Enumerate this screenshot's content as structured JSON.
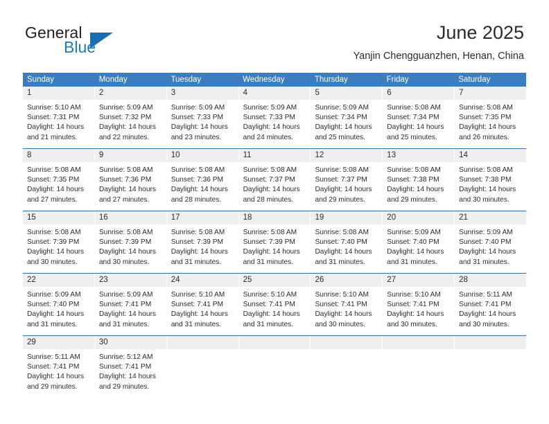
{
  "brand": {
    "name_part1": "General",
    "name_part2": "Blue",
    "triangle_icon": "triangle-icon",
    "accent_color": "#1b6cb0"
  },
  "header": {
    "title": "June 2025",
    "subtitle": "Yanjin Chengguanzhen, Henan, China"
  },
  "colors": {
    "header_blue": "#3b7dbf",
    "week_divider": "#2f6ca8",
    "daynum_band": "#efefef",
    "text": "#2b2b2b"
  },
  "weekday_headers": [
    "Sunday",
    "Monday",
    "Tuesday",
    "Wednesday",
    "Thursday",
    "Friday",
    "Saturday"
  ],
  "weeks": [
    [
      {
        "day": "1",
        "sunrise": "Sunrise: 5:10 AM",
        "sunset": "Sunset: 7:31 PM",
        "daylight1": "Daylight: 14 hours",
        "daylight2": "and 21 minutes."
      },
      {
        "day": "2",
        "sunrise": "Sunrise: 5:09 AM",
        "sunset": "Sunset: 7:32 PM",
        "daylight1": "Daylight: 14 hours",
        "daylight2": "and 22 minutes."
      },
      {
        "day": "3",
        "sunrise": "Sunrise: 5:09 AM",
        "sunset": "Sunset: 7:33 PM",
        "daylight1": "Daylight: 14 hours",
        "daylight2": "and 23 minutes."
      },
      {
        "day": "4",
        "sunrise": "Sunrise: 5:09 AM",
        "sunset": "Sunset: 7:33 PM",
        "daylight1": "Daylight: 14 hours",
        "daylight2": "and 24 minutes."
      },
      {
        "day": "5",
        "sunrise": "Sunrise: 5:09 AM",
        "sunset": "Sunset: 7:34 PM",
        "daylight1": "Daylight: 14 hours",
        "daylight2": "and 25 minutes."
      },
      {
        "day": "6",
        "sunrise": "Sunrise: 5:08 AM",
        "sunset": "Sunset: 7:34 PM",
        "daylight1": "Daylight: 14 hours",
        "daylight2": "and 25 minutes."
      },
      {
        "day": "7",
        "sunrise": "Sunrise: 5:08 AM",
        "sunset": "Sunset: 7:35 PM",
        "daylight1": "Daylight: 14 hours",
        "daylight2": "and 26 minutes."
      }
    ],
    [
      {
        "day": "8",
        "sunrise": "Sunrise: 5:08 AM",
        "sunset": "Sunset: 7:35 PM",
        "daylight1": "Daylight: 14 hours",
        "daylight2": "and 27 minutes."
      },
      {
        "day": "9",
        "sunrise": "Sunrise: 5:08 AM",
        "sunset": "Sunset: 7:36 PM",
        "daylight1": "Daylight: 14 hours",
        "daylight2": "and 27 minutes."
      },
      {
        "day": "10",
        "sunrise": "Sunrise: 5:08 AM",
        "sunset": "Sunset: 7:36 PM",
        "daylight1": "Daylight: 14 hours",
        "daylight2": "and 28 minutes."
      },
      {
        "day": "11",
        "sunrise": "Sunrise: 5:08 AM",
        "sunset": "Sunset: 7:37 PM",
        "daylight1": "Daylight: 14 hours",
        "daylight2": "and 28 minutes."
      },
      {
        "day": "12",
        "sunrise": "Sunrise: 5:08 AM",
        "sunset": "Sunset: 7:37 PM",
        "daylight1": "Daylight: 14 hours",
        "daylight2": "and 29 minutes."
      },
      {
        "day": "13",
        "sunrise": "Sunrise: 5:08 AM",
        "sunset": "Sunset: 7:38 PM",
        "daylight1": "Daylight: 14 hours",
        "daylight2": "and 29 minutes."
      },
      {
        "day": "14",
        "sunrise": "Sunrise: 5:08 AM",
        "sunset": "Sunset: 7:38 PM",
        "daylight1": "Daylight: 14 hours",
        "daylight2": "and 30 minutes."
      }
    ],
    [
      {
        "day": "15",
        "sunrise": "Sunrise: 5:08 AM",
        "sunset": "Sunset: 7:39 PM",
        "daylight1": "Daylight: 14 hours",
        "daylight2": "and 30 minutes."
      },
      {
        "day": "16",
        "sunrise": "Sunrise: 5:08 AM",
        "sunset": "Sunset: 7:39 PM",
        "daylight1": "Daylight: 14 hours",
        "daylight2": "and 30 minutes."
      },
      {
        "day": "17",
        "sunrise": "Sunrise: 5:08 AM",
        "sunset": "Sunset: 7:39 PM",
        "daylight1": "Daylight: 14 hours",
        "daylight2": "and 31 minutes."
      },
      {
        "day": "18",
        "sunrise": "Sunrise: 5:08 AM",
        "sunset": "Sunset: 7:39 PM",
        "daylight1": "Daylight: 14 hours",
        "daylight2": "and 31 minutes."
      },
      {
        "day": "19",
        "sunrise": "Sunrise: 5:08 AM",
        "sunset": "Sunset: 7:40 PM",
        "daylight1": "Daylight: 14 hours",
        "daylight2": "and 31 minutes."
      },
      {
        "day": "20",
        "sunrise": "Sunrise: 5:09 AM",
        "sunset": "Sunset: 7:40 PM",
        "daylight1": "Daylight: 14 hours",
        "daylight2": "and 31 minutes."
      },
      {
        "day": "21",
        "sunrise": "Sunrise: 5:09 AM",
        "sunset": "Sunset: 7:40 PM",
        "daylight1": "Daylight: 14 hours",
        "daylight2": "and 31 minutes."
      }
    ],
    [
      {
        "day": "22",
        "sunrise": "Sunrise: 5:09 AM",
        "sunset": "Sunset: 7:40 PM",
        "daylight1": "Daylight: 14 hours",
        "daylight2": "and 31 minutes."
      },
      {
        "day": "23",
        "sunrise": "Sunrise: 5:09 AM",
        "sunset": "Sunset: 7:41 PM",
        "daylight1": "Daylight: 14 hours",
        "daylight2": "and 31 minutes."
      },
      {
        "day": "24",
        "sunrise": "Sunrise: 5:10 AM",
        "sunset": "Sunset: 7:41 PM",
        "daylight1": "Daylight: 14 hours",
        "daylight2": "and 31 minutes."
      },
      {
        "day": "25",
        "sunrise": "Sunrise: 5:10 AM",
        "sunset": "Sunset: 7:41 PM",
        "daylight1": "Daylight: 14 hours",
        "daylight2": "and 31 minutes."
      },
      {
        "day": "26",
        "sunrise": "Sunrise: 5:10 AM",
        "sunset": "Sunset: 7:41 PM",
        "daylight1": "Daylight: 14 hours",
        "daylight2": "and 30 minutes."
      },
      {
        "day": "27",
        "sunrise": "Sunrise: 5:10 AM",
        "sunset": "Sunset: 7:41 PM",
        "daylight1": "Daylight: 14 hours",
        "daylight2": "and 30 minutes."
      },
      {
        "day": "28",
        "sunrise": "Sunrise: 5:11 AM",
        "sunset": "Sunset: 7:41 PM",
        "daylight1": "Daylight: 14 hours",
        "daylight2": "and 30 minutes."
      }
    ],
    [
      {
        "day": "29",
        "sunrise": "Sunrise: 5:11 AM",
        "sunset": "Sunset: 7:41 PM",
        "daylight1": "Daylight: 14 hours",
        "daylight2": "and 29 minutes."
      },
      {
        "day": "30",
        "sunrise": "Sunrise: 5:12 AM",
        "sunset": "Sunset: 7:41 PM",
        "daylight1": "Daylight: 14 hours",
        "daylight2": "and 29 minutes."
      },
      {
        "day": "",
        "sunrise": "",
        "sunset": "",
        "daylight1": "",
        "daylight2": ""
      },
      {
        "day": "",
        "sunrise": "",
        "sunset": "",
        "daylight1": "",
        "daylight2": ""
      },
      {
        "day": "",
        "sunrise": "",
        "sunset": "",
        "daylight1": "",
        "daylight2": ""
      },
      {
        "day": "",
        "sunrise": "",
        "sunset": "",
        "daylight1": "",
        "daylight2": ""
      },
      {
        "day": "",
        "sunrise": "",
        "sunset": "",
        "daylight1": "",
        "daylight2": ""
      }
    ]
  ]
}
